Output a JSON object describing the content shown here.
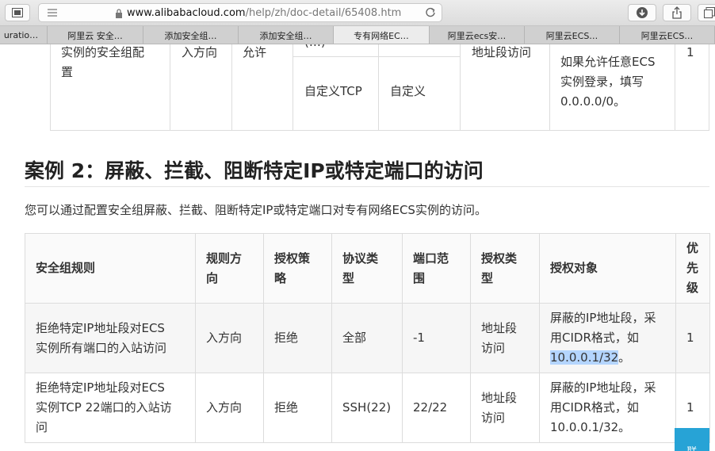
{
  "browser": {
    "url_host": "www.alibabacloud.com",
    "url_path": "/help/zh/doc-detail/65408.htm",
    "tabs": [
      {
        "label": "uratio…",
        "active": false
      },
      {
        "label": "阿里云 安全…",
        "active": false
      },
      {
        "label": "添加安全组…",
        "active": false
      },
      {
        "label": "添加安全组…",
        "active": false
      },
      {
        "label": "专有网络EC…",
        "active": true
      },
      {
        "label": "阿里云ecs安…",
        "active": false
      },
      {
        "label": "阿里云ECS…",
        "active": false
      },
      {
        "label": "阿里云ECS…",
        "active": false
      }
    ]
  },
  "prev_table": {
    "rule": "实例的安全组配\n置",
    "direction": "入方向",
    "policy": "允许",
    "protocol_partial": "(…)",
    "protocol": "自定义TCP",
    "port": "自定义",
    "auth_type": "地址段访问",
    "auth_object": "如果允许任意ECS\n实例登录，填写\n0.0.0.0/0。",
    "priority": "1"
  },
  "section": {
    "heading": "案例 2：屏蔽、拦截、阻断特定IP或特定端口的访问",
    "intro": "您可以通过配置安全组屏蔽、拦截、阻断特定IP或特定端口对专有网络ECS实例的访问。"
  },
  "table": {
    "headers": [
      "安全组规则",
      "规则方\n向",
      "授权策\n略",
      "协议类\n型",
      "端口范\n围",
      "授权类\n型",
      "授权对象",
      "优\n先\n级"
    ],
    "rows": [
      {
        "rule": "拒绝特定IP地址段对ECS\n实例所有端口的入站访问",
        "direction": "入方向",
        "policy": "拒绝",
        "protocol": "全部",
        "port": "-1",
        "auth_type": "地址段\n访问",
        "auth_object_prefix": "屏蔽的IP地址段，采\n用CIDR格式，如\n",
        "auth_object_highlight": "10.0.0.1/32",
        "auth_object_suffix": "。",
        "priority": "1"
      },
      {
        "rule": "拒绝特定IP地址段对ECS\n实例TCP 22端口的入站访\n问",
        "direction": "入方向",
        "policy": "拒绝",
        "protocol": "SSH(22)",
        "port": "22/22",
        "auth_type": "地址段\n访问",
        "auth_object": "屏蔽的IP地址段，采\n用CIDR格式，如\n10.0.0.1/32。",
        "priority": "1"
      }
    ]
  },
  "chat_button": {
    "label": "联"
  }
}
